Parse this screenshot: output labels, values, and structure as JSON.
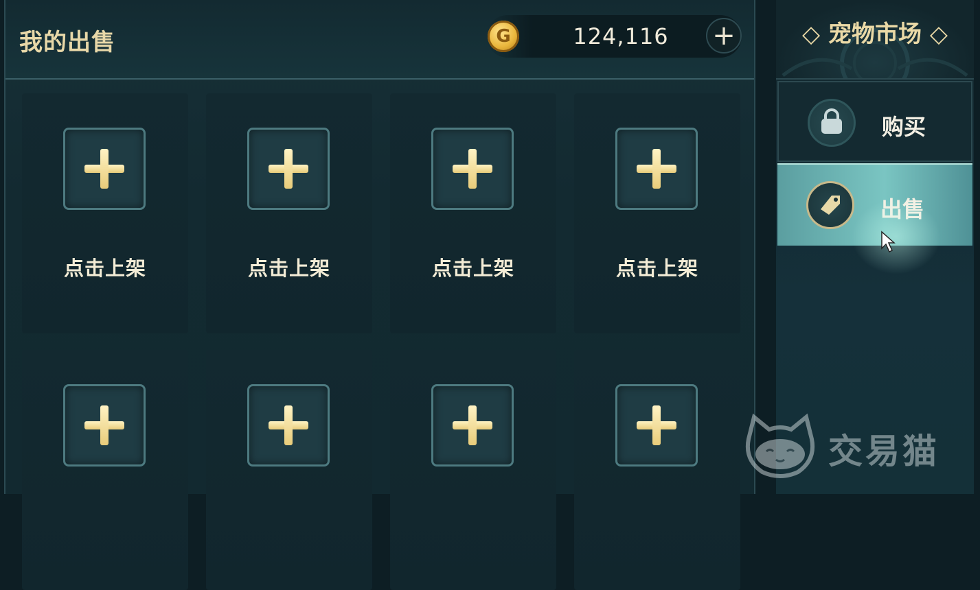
{
  "my_sales": {
    "title": "我的出售",
    "gold_icon_letter": "G",
    "gold_amount": "124,116",
    "add_gold_symbol": "+"
  },
  "slots": [
    {
      "label": "点击上架"
    },
    {
      "label": "点击上架"
    },
    {
      "label": "点击上架"
    },
    {
      "label": "点击上架"
    },
    {
      "label": ""
    },
    {
      "label": ""
    },
    {
      "label": ""
    },
    {
      "label": ""
    }
  ],
  "market": {
    "title": "◇ 宠物市场 ◇",
    "tabs": [
      {
        "label": "购买",
        "icon": "bag-icon",
        "active": false
      },
      {
        "label": "出售",
        "icon": "price-tag-icon",
        "active": true
      }
    ]
  },
  "watermark": {
    "text": "交易猫"
  },
  "colors": {
    "gold_text": "#e8d8a8",
    "panel_bg": "#132a31",
    "active_tab": "#7ac5c2",
    "plus_cross": "#e8cc7a"
  }
}
